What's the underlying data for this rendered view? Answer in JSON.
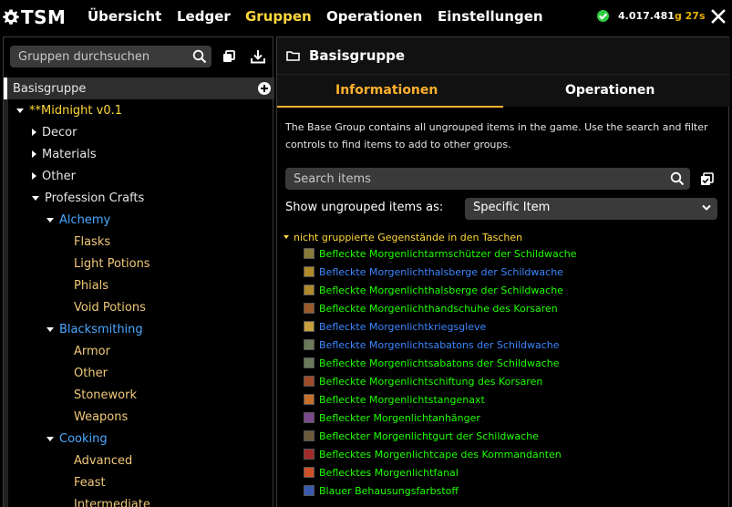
{
  "app": {
    "logo_text": "TSM",
    "nav": [
      "Übersicht",
      "Ledger",
      "Gruppen",
      "Operationen",
      "Einstellungen"
    ],
    "active_nav": "Gruppen",
    "gold_amount": "4.017.481",
    "gold_suffix": "g 27s"
  },
  "left": {
    "search_placeholder": "Gruppen durchsuchen",
    "tree": [
      {
        "label": "Basisgruppe",
        "level": 0,
        "state": "selected",
        "color": "white"
      },
      {
        "label": "**Midnight v0.1",
        "level": 1,
        "state": "expanded",
        "color": "gold"
      },
      {
        "label": "Decor",
        "level": 2,
        "state": "collapsed",
        "color": "white"
      },
      {
        "label": "Materials",
        "level": 2,
        "state": "collapsed",
        "color": "white"
      },
      {
        "label": "Other",
        "level": 2,
        "state": "collapsed",
        "color": "white"
      },
      {
        "label": "Profession Crafts",
        "level": 2,
        "state": "expanded",
        "color": "white"
      },
      {
        "label": "Alchemy",
        "level": 3,
        "state": "expanded",
        "color": "blue"
      },
      {
        "label": "Flasks",
        "level": 4,
        "state": "leaf",
        "color": "leaf"
      },
      {
        "label": "Light Potions",
        "level": 4,
        "state": "leaf",
        "color": "leaf"
      },
      {
        "label": "Phials",
        "level": 4,
        "state": "leaf",
        "color": "leaf"
      },
      {
        "label": "Void Potions",
        "level": 4,
        "state": "leaf",
        "color": "leaf"
      },
      {
        "label": "Blacksmithing",
        "level": 3,
        "state": "expanded",
        "color": "blue"
      },
      {
        "label": "Armor",
        "level": 4,
        "state": "leaf",
        "color": "leaf"
      },
      {
        "label": "Other",
        "level": 4,
        "state": "leaf",
        "color": "leaf"
      },
      {
        "label": "Stonework",
        "level": 4,
        "state": "leaf",
        "color": "leaf"
      },
      {
        "label": "Weapons",
        "level": 4,
        "state": "leaf",
        "color": "leaf"
      },
      {
        "label": "Cooking",
        "level": 3,
        "state": "expanded",
        "color": "blue"
      },
      {
        "label": "Advanced",
        "level": 4,
        "state": "leaf",
        "color": "leaf"
      },
      {
        "label": "Feast",
        "level": 4,
        "state": "leaf",
        "color": "leaf"
      },
      {
        "label": "Intermediate",
        "level": 4,
        "state": "leaf",
        "color": "leaf"
      }
    ]
  },
  "right": {
    "title": "Basisgruppe",
    "tabs": [
      "Informationen",
      "Operationen"
    ],
    "active_tab": "Informationen",
    "description": "The Base Group contains all ungrouped items in the game. Use the search and filter controls to find items to add to other groups.",
    "item_search_placeholder": "Search items",
    "show_label": "Show ungrouped items as:",
    "dropdown_value": "Specific Item",
    "items_header": "nicht gruppierte Gegenstände in den Taschen",
    "items": [
      {
        "name": "Befleckte Morgenlichtarmschützer der Schildwache",
        "quality": "green",
        "icon_color": "#8a7a3a"
      },
      {
        "name": "Befleckte Morgenlichthalsberge der Schildwache",
        "quality": "blue",
        "icon_color": "#b08a2a"
      },
      {
        "name": "Befleckte Morgenlichthalsberge der Schildwache",
        "quality": "green",
        "icon_color": "#b08a2a"
      },
      {
        "name": "Befleckte Morgenlichthandschuhe des Korsaren",
        "quality": "green",
        "icon_color": "#9a5a2a"
      },
      {
        "name": "Befleckte Morgenlichtkriegsgleve",
        "quality": "blue",
        "icon_color": "#c8a040"
      },
      {
        "name": "Befleckte Morgenlichtsabatons der Schildwache",
        "quality": "blue",
        "icon_color": "#6a7a5a"
      },
      {
        "name": "Befleckte Morgenlichtsabatons der Schildwache",
        "quality": "green",
        "icon_color": "#6a7a5a"
      },
      {
        "name": "Befleckte Morgenlichtschiftung des Korsaren",
        "quality": "green",
        "icon_color": "#a04a2a"
      },
      {
        "name": "Befleckte Morgenlichtstangenaxt",
        "quality": "green",
        "icon_color": "#c8702a"
      },
      {
        "name": "Befleckter Morgenlichtanhänger",
        "quality": "green",
        "icon_color": "#7a4a8a"
      },
      {
        "name": "Befleckter Morgenlichtgurt der Schildwache",
        "quality": "green",
        "icon_color": "#6a5a3a"
      },
      {
        "name": "Beflecktes Morgenlichtcape des Kommandanten",
        "quality": "green",
        "icon_color": "#a02a2a"
      },
      {
        "name": "Beflecktes Morgenlichtfanal",
        "quality": "green",
        "icon_color": "#d0502a"
      },
      {
        "name": "Blauer Behausungsfarbstoff",
        "quality": "green",
        "icon_color": "#3a5ab0"
      }
    ]
  },
  "colors": {
    "accent_gold": "#ffd83c",
    "tab_orange": "#ffb02e",
    "tree_blue": "#4aa8ff",
    "quality_green": "#1eff00",
    "quality_blue": "#3b86ff"
  }
}
